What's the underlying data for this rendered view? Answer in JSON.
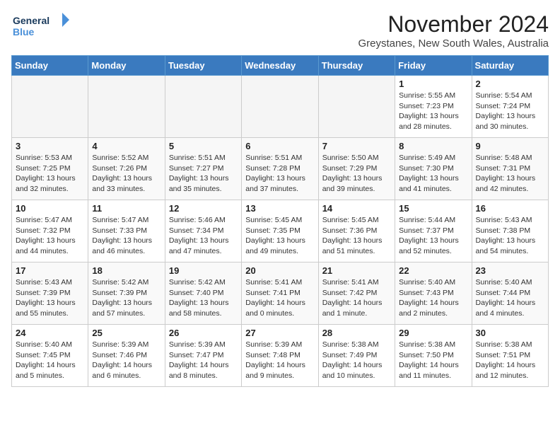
{
  "logo": {
    "line1": "General",
    "line2": "Blue"
  },
  "title": "November 2024",
  "location": "Greystanes, New South Wales, Australia",
  "days_header": [
    "Sunday",
    "Monday",
    "Tuesday",
    "Wednesday",
    "Thursday",
    "Friday",
    "Saturday"
  ],
  "weeks": [
    [
      {
        "day": "",
        "info": ""
      },
      {
        "day": "",
        "info": ""
      },
      {
        "day": "",
        "info": ""
      },
      {
        "day": "",
        "info": ""
      },
      {
        "day": "",
        "info": ""
      },
      {
        "day": "1",
        "info": "Sunrise: 5:55 AM\nSunset: 7:23 PM\nDaylight: 13 hours\nand 28 minutes."
      },
      {
        "day": "2",
        "info": "Sunrise: 5:54 AM\nSunset: 7:24 PM\nDaylight: 13 hours\nand 30 minutes."
      }
    ],
    [
      {
        "day": "3",
        "info": "Sunrise: 5:53 AM\nSunset: 7:25 PM\nDaylight: 13 hours\nand 32 minutes."
      },
      {
        "day": "4",
        "info": "Sunrise: 5:52 AM\nSunset: 7:26 PM\nDaylight: 13 hours\nand 33 minutes."
      },
      {
        "day": "5",
        "info": "Sunrise: 5:51 AM\nSunset: 7:27 PM\nDaylight: 13 hours\nand 35 minutes."
      },
      {
        "day": "6",
        "info": "Sunrise: 5:51 AM\nSunset: 7:28 PM\nDaylight: 13 hours\nand 37 minutes."
      },
      {
        "day": "7",
        "info": "Sunrise: 5:50 AM\nSunset: 7:29 PM\nDaylight: 13 hours\nand 39 minutes."
      },
      {
        "day": "8",
        "info": "Sunrise: 5:49 AM\nSunset: 7:30 PM\nDaylight: 13 hours\nand 41 minutes."
      },
      {
        "day": "9",
        "info": "Sunrise: 5:48 AM\nSunset: 7:31 PM\nDaylight: 13 hours\nand 42 minutes."
      }
    ],
    [
      {
        "day": "10",
        "info": "Sunrise: 5:47 AM\nSunset: 7:32 PM\nDaylight: 13 hours\nand 44 minutes."
      },
      {
        "day": "11",
        "info": "Sunrise: 5:47 AM\nSunset: 7:33 PM\nDaylight: 13 hours\nand 46 minutes."
      },
      {
        "day": "12",
        "info": "Sunrise: 5:46 AM\nSunset: 7:34 PM\nDaylight: 13 hours\nand 47 minutes."
      },
      {
        "day": "13",
        "info": "Sunrise: 5:45 AM\nSunset: 7:35 PM\nDaylight: 13 hours\nand 49 minutes."
      },
      {
        "day": "14",
        "info": "Sunrise: 5:45 AM\nSunset: 7:36 PM\nDaylight: 13 hours\nand 51 minutes."
      },
      {
        "day": "15",
        "info": "Sunrise: 5:44 AM\nSunset: 7:37 PM\nDaylight: 13 hours\nand 52 minutes."
      },
      {
        "day": "16",
        "info": "Sunrise: 5:43 AM\nSunset: 7:38 PM\nDaylight: 13 hours\nand 54 minutes."
      }
    ],
    [
      {
        "day": "17",
        "info": "Sunrise: 5:43 AM\nSunset: 7:39 PM\nDaylight: 13 hours\nand 55 minutes."
      },
      {
        "day": "18",
        "info": "Sunrise: 5:42 AM\nSunset: 7:39 PM\nDaylight: 13 hours\nand 57 minutes."
      },
      {
        "day": "19",
        "info": "Sunrise: 5:42 AM\nSunset: 7:40 PM\nDaylight: 13 hours\nand 58 minutes."
      },
      {
        "day": "20",
        "info": "Sunrise: 5:41 AM\nSunset: 7:41 PM\nDaylight: 14 hours\nand 0 minutes."
      },
      {
        "day": "21",
        "info": "Sunrise: 5:41 AM\nSunset: 7:42 PM\nDaylight: 14 hours\nand 1 minute."
      },
      {
        "day": "22",
        "info": "Sunrise: 5:40 AM\nSunset: 7:43 PM\nDaylight: 14 hours\nand 2 minutes."
      },
      {
        "day": "23",
        "info": "Sunrise: 5:40 AM\nSunset: 7:44 PM\nDaylight: 14 hours\nand 4 minutes."
      }
    ],
    [
      {
        "day": "24",
        "info": "Sunrise: 5:40 AM\nSunset: 7:45 PM\nDaylight: 14 hours\nand 5 minutes."
      },
      {
        "day": "25",
        "info": "Sunrise: 5:39 AM\nSunset: 7:46 PM\nDaylight: 14 hours\nand 6 minutes."
      },
      {
        "day": "26",
        "info": "Sunrise: 5:39 AM\nSunset: 7:47 PM\nDaylight: 14 hours\nand 8 minutes."
      },
      {
        "day": "27",
        "info": "Sunrise: 5:39 AM\nSunset: 7:48 PM\nDaylight: 14 hours\nand 9 minutes."
      },
      {
        "day": "28",
        "info": "Sunrise: 5:38 AM\nSunset: 7:49 PM\nDaylight: 14 hours\nand 10 minutes."
      },
      {
        "day": "29",
        "info": "Sunrise: 5:38 AM\nSunset: 7:50 PM\nDaylight: 14 hours\nand 11 minutes."
      },
      {
        "day": "30",
        "info": "Sunrise: 5:38 AM\nSunset: 7:51 PM\nDaylight: 14 hours\nand 12 minutes."
      }
    ]
  ]
}
